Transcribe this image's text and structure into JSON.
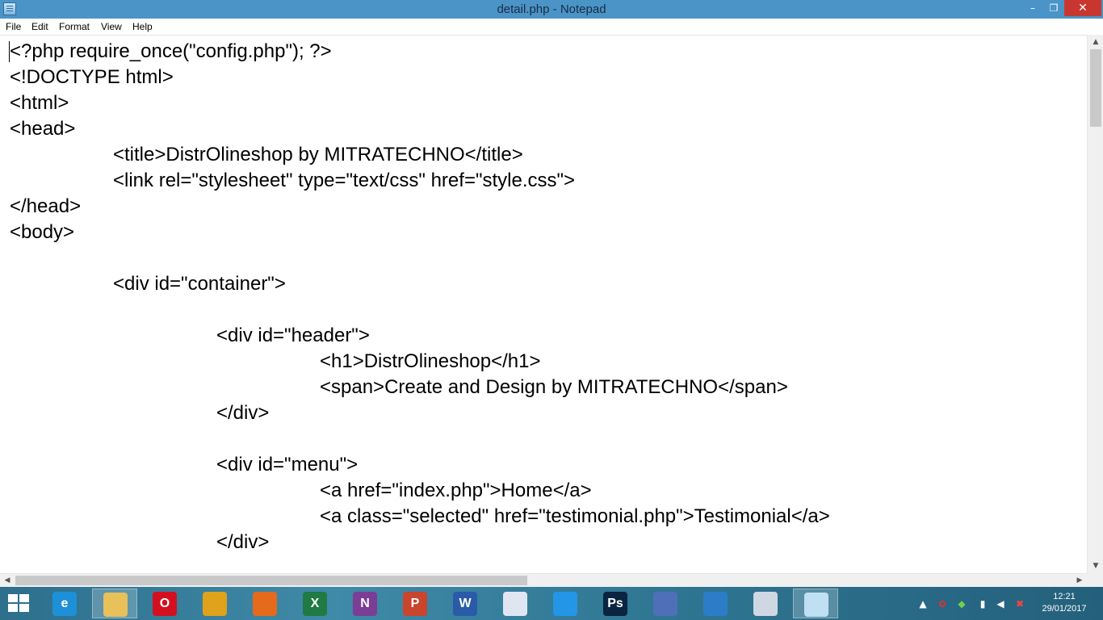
{
  "window": {
    "title": "detail.php - Notepad",
    "minimize_glyph": "–",
    "maximize_glyph": "❐",
    "close_glyph": "✕"
  },
  "menu": {
    "items": [
      "File",
      "Edit",
      "Format",
      "View",
      "Help"
    ]
  },
  "editor": {
    "lines": [
      "<?php require_once(\"config.php\"); ?>",
      "<!DOCTYPE html>",
      "<html>",
      "<head>",
      "\t<title>DistrOlineshop by MITRATECHNO</title>",
      "\t<link rel=\"stylesheet\" type=\"text/css\" href=\"style.css\">",
      "</head>",
      "<body>",
      "",
      "\t<div id=\"container\">",
      "",
      "\t\t<div id=\"header\">",
      "\t\t\t<h1>DistrOlineshop</h1>",
      "\t\t\t<span>Create and Design by MITRATECHNO</span>",
      "\t\t</div>",
      "",
      "\t\t<div id=\"menu\">",
      "\t\t\t<a href=\"index.php\">Home</a>",
      "\t\t\t<a class=\"selected\" href=\"testimonial.php\">Testimonial</a>",
      "\t\t</div>"
    ]
  },
  "taskbar": {
    "apps": [
      {
        "name": "internet-explorer",
        "label": "e",
        "color": "#1e90d8"
      },
      {
        "name": "file-explorer",
        "label": "",
        "color": "#e8c15a",
        "active": true
      },
      {
        "name": "opera",
        "label": "O",
        "color": "#d4101f"
      },
      {
        "name": "chrome",
        "label": "",
        "color": "#e0a21a"
      },
      {
        "name": "firefox",
        "label": "",
        "color": "#e66a1b"
      },
      {
        "name": "excel",
        "label": "X",
        "color": "#1f7a44"
      },
      {
        "name": "onenote",
        "label": "N",
        "color": "#7b3d96"
      },
      {
        "name": "powerpoint",
        "label": "P",
        "color": "#c9452c"
      },
      {
        "name": "word",
        "label": "W",
        "color": "#2a5ba8"
      },
      {
        "name": "paint",
        "label": "",
        "color": "#dfe6f2"
      },
      {
        "name": "shareit",
        "label": "",
        "color": "#2396e8"
      },
      {
        "name": "photoshop",
        "label": "Ps",
        "color": "#0b2440"
      },
      {
        "name": "storm-app",
        "label": "",
        "color": "#4f6fb8"
      },
      {
        "name": "browser-blue",
        "label": "",
        "color": "#2c7dc7"
      },
      {
        "name": "network-tool",
        "label": "",
        "color": "#cfd8e2"
      },
      {
        "name": "notepad",
        "label": "",
        "color": "#bfe0f2",
        "active": true
      }
    ],
    "clock": {
      "time": "12:21",
      "date": "29/01/2017"
    }
  }
}
